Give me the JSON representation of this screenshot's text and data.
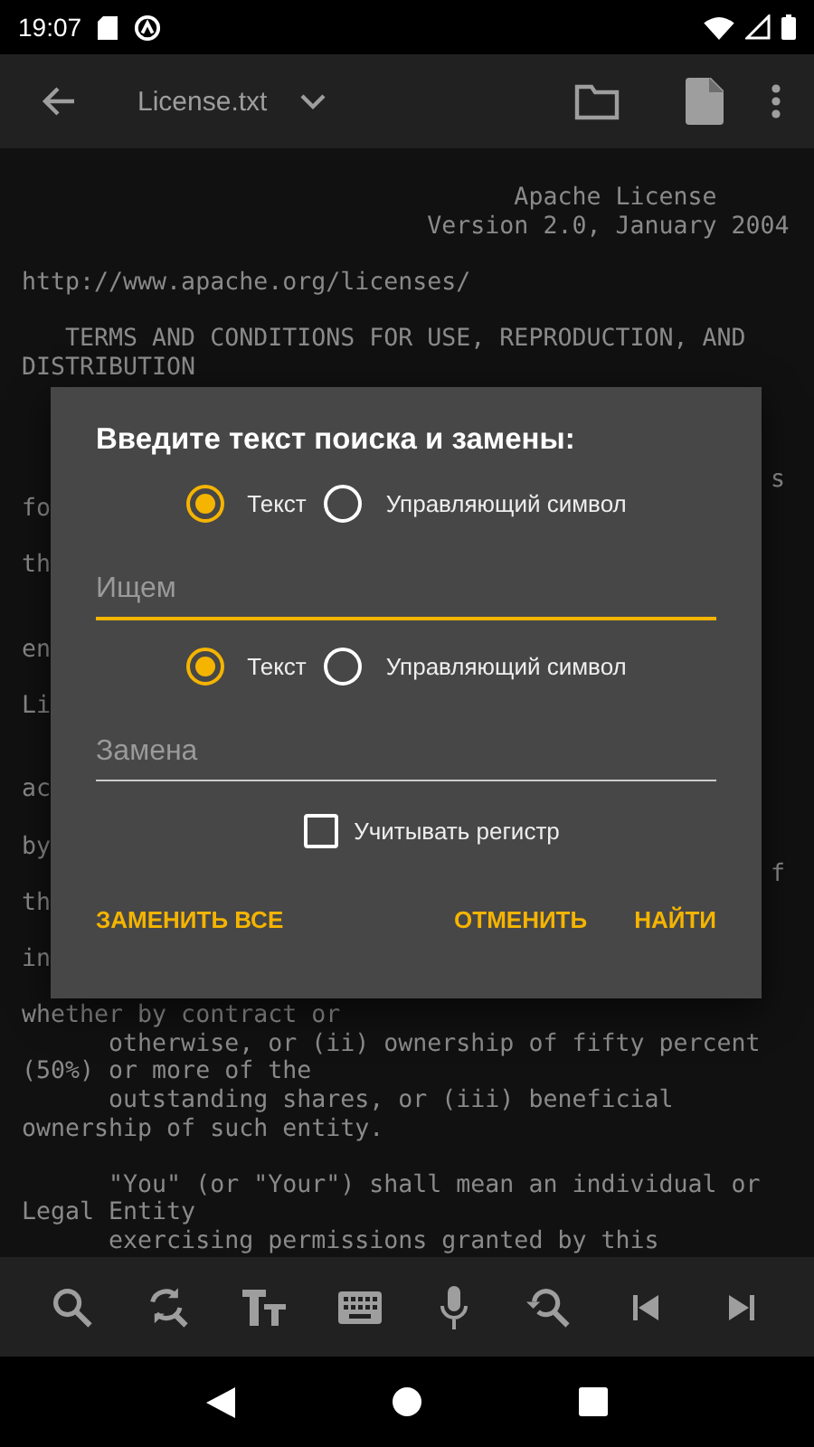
{
  "status_bar": {
    "time": "19:07"
  },
  "app_bar": {
    "file_name": "License.txt"
  },
  "editor": {
    "lines": [
      {
        "kind": "line",
        "text": "                                  Apache License"
      },
      {
        "kind": "line",
        "text": "                            Version 2.0, January 2004"
      },
      {
        "kind": "blank"
      },
      {
        "kind": "line",
        "text": "http://www.apache.org/licenses/"
      },
      {
        "kind": "blank"
      },
      {
        "kind": "line",
        "text": "   TERMS AND CONDITIONS FOR USE, REPRODUCTION, AND"
      },
      {
        "kind": "line",
        "text": "DISTRIBUTION"
      },
      {
        "kind": "blank"
      },
      {
        "kind": "blank"
      },
      {
        "kind": "blank"
      },
      {
        "kind": "line",
        "tail": "s"
      },
      {
        "kind": "line",
        "text": "fo"
      },
      {
        "kind": "blank"
      },
      {
        "kind": "line",
        "text": "th"
      },
      {
        "kind": "blank"
      },
      {
        "kind": "blank"
      },
      {
        "kind": "line",
        "text": "en"
      },
      {
        "kind": "blank"
      },
      {
        "kind": "line",
        "text": "Li"
      },
      {
        "kind": "blank"
      },
      {
        "kind": "blank"
      },
      {
        "kind": "line",
        "text": "ac"
      },
      {
        "kind": "blank"
      },
      {
        "kind": "line",
        "text": "by"
      },
      {
        "kind": "line",
        "tail": "f"
      },
      {
        "kind": "line",
        "text": "th"
      },
      {
        "kind": "blank"
      },
      {
        "kind": "line",
        "text": "in"
      },
      {
        "kind": "blank"
      },
      {
        "kind": "line",
        "text": "whether by contract or"
      },
      {
        "kind": "line",
        "text": "      otherwise, or (ii) ownership of fifty percent"
      },
      {
        "kind": "line",
        "text": "(50%) or more of the"
      },
      {
        "kind": "line",
        "text": "      outstanding shares, or (iii) beneficial"
      },
      {
        "kind": "line",
        "text": "ownership of such entity."
      },
      {
        "kind": "blank"
      },
      {
        "kind": "line",
        "text": "      \"You\" (or \"Your\") shall mean an individual or"
      },
      {
        "kind": "line",
        "text": "Legal Entity"
      },
      {
        "kind": "line",
        "text": "      exercising permissions granted by this"
      }
    ]
  },
  "dialog": {
    "title": "Введите текст поиска и замены:",
    "search_mode": [
      {
        "label": "Текст",
        "selected": true
      },
      {
        "label": "Управляющий символ",
        "selected": false
      }
    ],
    "search_field": {
      "placeholder": "Ищем",
      "focused": true
    },
    "replace_mode": [
      {
        "label": "Текст",
        "selected": true
      },
      {
        "label": "Управляющий символ",
        "selected": false
      }
    ],
    "replace_field": {
      "placeholder": "Замена",
      "focused": false
    },
    "match_case": {
      "label": "Учитывать регистр",
      "checked": false
    },
    "buttons": [
      {
        "label": "ЗАМЕНИТЬ ВСЕ"
      },
      {
        "label": "ОТМЕНИТЬ"
      },
      {
        "label": "НАЙТИ"
      }
    ]
  },
  "toolbar": {
    "buttons": [
      {
        "kind": "search"
      },
      {
        "kind": "replace"
      },
      {
        "kind": "text-size"
      },
      {
        "kind": "keyboard"
      },
      {
        "kind": "microphone"
      },
      {
        "kind": "search-back"
      },
      {
        "kind": "skip-previous"
      },
      {
        "kind": "skip-next"
      }
    ]
  }
}
